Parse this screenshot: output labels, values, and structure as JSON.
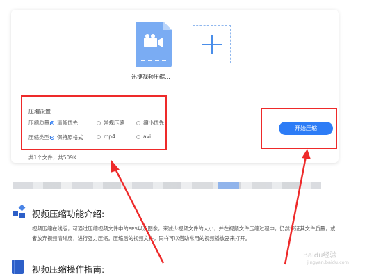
{
  "uploader": {
    "file_name": "迅捷视频压缩...",
    "file_count": "共1个文件，共509K"
  },
  "settings": {
    "title": "压缩设置",
    "quality_label": "压缩质量:",
    "quality_options": [
      "清晰优先",
      "常规压缩",
      "缩小优先"
    ],
    "quality_selected": "清晰优先",
    "type_label": "压缩类型:",
    "type_options": [
      "保持原格式",
      "mp4",
      "avi"
    ],
    "type_selected": "保持原格式"
  },
  "actions": {
    "start_label": "开始压缩"
  },
  "article": {
    "section1_title": "视频压缩功能介绍:",
    "section1_text": "视频压缩在线版，可通过压缩视频文件中的FPS以及图像，来减少视频文件的大小，并在视频文件压缩过程中，仍然保证其文件质量，或者放弃视频清晰度，进行强力压缩。压缩后的视频文件，同样可以借助常用的视频播放器来打开。",
    "section2_title": "视频压缩操作指南:"
  },
  "watermark": {
    "main": "Baidu经验",
    "sub": "jingyan.baidu.com"
  },
  "colors": {
    "accent": "#2d7cf6",
    "annotation_red": "#ee2a2a",
    "file_icon": "#7aacf3"
  }
}
